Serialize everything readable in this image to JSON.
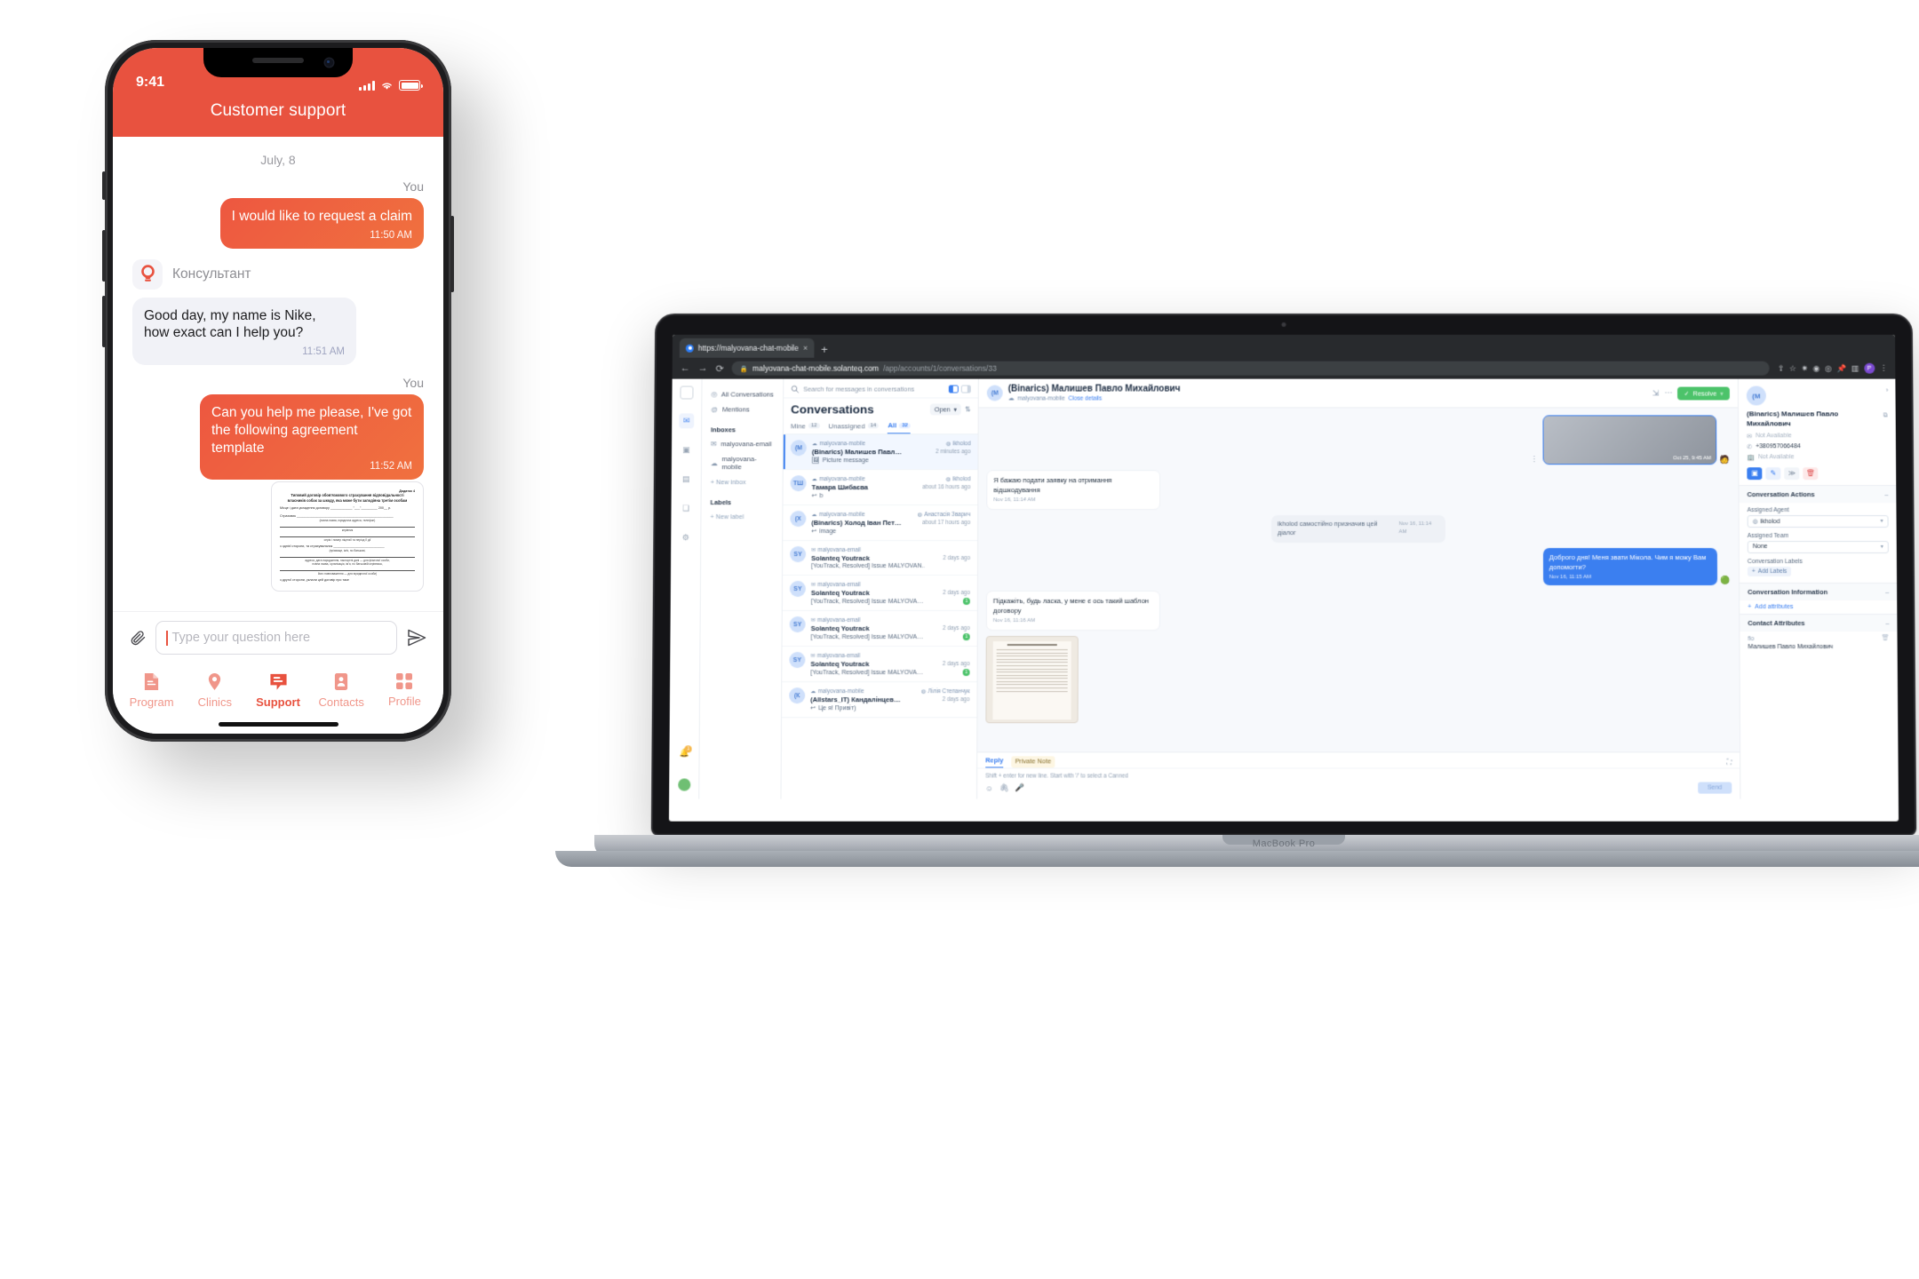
{
  "phone": {
    "status": {
      "time": "9:41"
    },
    "nav_title": "Customer support",
    "day_label": "July, 8",
    "you_label": "You",
    "messages": [
      {
        "side": "out",
        "who": "You",
        "text": "I would like to request a claim",
        "time": "11:50 AM"
      },
      {
        "side": "in",
        "who": "Консультант",
        "text": "Good day, my name is Nike, how exact can I help you?",
        "time": "11:51 AM"
      },
      {
        "side": "out",
        "who": "You",
        "text": "Can you help me please, I've got the following agreement template",
        "time": "11:52 AM"
      }
    ],
    "document": {
      "annex": "Додаток 4",
      "title_line1": "Типовий договір обов'язкового страхування відповідальності",
      "title_line2": "власників собак за шкоду, яка може бути заподіяна третім особам",
      "row_place": "Місце і дата укладення договору ____________ \"___\"_________ 200__ р.",
      "row_insurer": "Страховик _____________________________________________________",
      "cap_fullname": "(повна назва, юридична адреса, телефон)",
      "cap_director": "керівник",
      "cap_series": "серія і номер ліцензії та період її дії",
      "row_party": "з однієї сторони, та страхувальник ____________________________",
      "cap_party": "(прізвище, ім'я, по батькові,",
      "cap_addr": "адреса, дата народження, паспортні дані — для фізичної особи,",
      "cap_addr2": "повна назва, організація, ім'я, по батьковій керівника,",
      "cap_legal": "його повноваження — для юридичної особи)",
      "row_end": "з другої сторони, уклали цей договір про таке"
    },
    "composer": {
      "placeholder": "Type your question here",
      "attach_icon": "paperclip-icon",
      "send_icon": "send-icon"
    },
    "tabs": [
      {
        "label": "Program",
        "icon": "document-icon",
        "active": false
      },
      {
        "label": "Clinics",
        "icon": "map-pin-icon",
        "active": false
      },
      {
        "label": "Support",
        "icon": "chat-bubble-icon",
        "active": true
      },
      {
        "label": "Contacts",
        "icon": "contacts-icon",
        "active": false
      },
      {
        "label": "Profile",
        "icon": "grid-icon",
        "active": false
      }
    ],
    "colors": {
      "accent": "#E8523F",
      "bubble_out": "#ED5740",
      "bubble_in": "#F1F2F7"
    }
  },
  "laptop": {
    "model_label": "MacBook Pro"
  },
  "browser": {
    "tab_title": "https://malyovana-chat-mobile",
    "tab_close": "×",
    "new_tab": "+",
    "url_bold": "malyovana-chat-mobile.solanteq.com",
    "url_path": "/app/accounts/1/conversations/33",
    "back": "←",
    "forward": "→",
    "reload": "⟳",
    "profile_initial": "P"
  },
  "app": {
    "rail": [
      {
        "name": "conversations-icon",
        "glyph": "✉",
        "selected": true
      },
      {
        "name": "contacts-icon",
        "glyph": "▣",
        "selected": false
      },
      {
        "name": "reports-icon",
        "glyph": "▤",
        "selected": false
      },
      {
        "name": "campaigns-icon",
        "glyph": "❏",
        "selected": false
      },
      {
        "name": "settings-icon",
        "glyph": "⚙",
        "selected": false
      }
    ],
    "notification_count": "1",
    "sidebar": {
      "all_conversations": "All Conversations",
      "mentions": "Mentions",
      "inboxes_header": "Inboxes",
      "inboxes": [
        {
          "label": "malyovana-email",
          "icon": "email-icon"
        },
        {
          "label": "malyovana-mobile",
          "icon": "cloud-icon"
        }
      ],
      "new_inbox": "+ New inbox",
      "labels_header": "Labels",
      "new_label": "+ New label"
    },
    "convlist": {
      "search_placeholder": "Search for messages in conversations",
      "title": "Conversations",
      "state_filter": "Open",
      "tabs": [
        {
          "label": "Mine",
          "count": "12",
          "active": false
        },
        {
          "label": "Unassigned",
          "count": "14",
          "active": false
        },
        {
          "label": "All",
          "count": "32",
          "active": true
        }
      ],
      "rows": [
        {
          "avatar": "(M",
          "inbox": "malyovana-mobile",
          "inbox_icon": "cloud-icon",
          "assignee": "ikholod",
          "name": "(Binarics) Малишев Павл…",
          "time": "2 minutes ago",
          "preview": "Picture message",
          "preview_icon": "image-icon",
          "unread": "",
          "selected": true
        },
        {
          "avatar": "ТШ",
          "inbox": "malyovana-mobile",
          "inbox_icon": "cloud-icon",
          "assignee": "ikholod",
          "name": "Тамара Шибаєва",
          "time": "about 16 hours ago",
          "preview": "b",
          "preview_icon": "reply-icon",
          "unread": "",
          "selected": false
        },
        {
          "avatar": "(X",
          "inbox": "malyovana-mobile",
          "inbox_icon": "cloud-icon",
          "assignee": "Анастасія Зварич",
          "name": "(Binarics) Холод Іван Пет…",
          "time": "about 17 hours ago",
          "preview": "image",
          "preview_icon": "reply-icon",
          "unread": "",
          "selected": false
        },
        {
          "avatar": "SY",
          "inbox": "malyovana-email",
          "inbox_icon": "email-icon",
          "assignee": "",
          "name": "Solanteq Youtrack",
          "time": "2 days ago",
          "preview": "[YouTrack, Resolved] Issue MALYOVAN…",
          "preview_icon": "",
          "unread": "",
          "selected": false
        },
        {
          "avatar": "SY",
          "inbox": "malyovana-email",
          "inbox_icon": "email-icon",
          "assignee": "",
          "name": "Solanteq Youtrack",
          "time": "2 days ago",
          "preview": "[YouTrack, Resolved] Issue MALYOVA…",
          "preview_icon": "",
          "unread": "1",
          "selected": false
        },
        {
          "avatar": "SY",
          "inbox": "malyovana-email",
          "inbox_icon": "email-icon",
          "assignee": "",
          "name": "Solanteq Youtrack",
          "time": "2 days ago",
          "preview": "[YouTrack, Resolved] Issue MALYOVA…",
          "preview_icon": "",
          "unread": "1",
          "selected": false
        },
        {
          "avatar": "SY",
          "inbox": "malyovana-email",
          "inbox_icon": "email-icon",
          "assignee": "",
          "name": "Solanteq Youtrack",
          "time": "2 days ago",
          "preview": "[YouTrack, Resolved] Issue MALYOVA…",
          "preview_icon": "",
          "unread": "1",
          "selected": false
        },
        {
          "avatar": "(К",
          "inbox": "malyovana-mobile",
          "inbox_icon": "cloud-icon",
          "assignee": "Лілія Степанчук",
          "name": "(Allstars_IT) Кандалінцев…",
          "time": "2 days ago",
          "preview": "Це я! Привіт)",
          "preview_icon": "reply-icon",
          "unread": "",
          "selected": false
        }
      ]
    },
    "thread": {
      "title": "(Binarics) Малишев Павло Михайлович",
      "inbox": "malyovana-mobile",
      "close_details": "Close details",
      "resolve_label": "Resolve",
      "resolve_check": "✓",
      "messages": [
        {
          "kind": "image",
          "side": "right",
          "time": "Oct 25, 9:45 AM"
        },
        {
          "kind": "text",
          "side": "left",
          "text": "Я бажаю подати заявку на отримання відшкодування",
          "time": "Nov 16, 11:14 AM"
        },
        {
          "kind": "system",
          "side": "center",
          "text": "ikholod самостійно призначив цей діалог",
          "time": "Nov 16, 11:14 AM"
        },
        {
          "kind": "text",
          "side": "right",
          "text": "Доброго дня! Меня звати Мікола. Чим я можу Вам допомогти?",
          "time": "Nov 16, 11:15 AM"
        },
        {
          "kind": "text",
          "side": "left",
          "text": "Підкажіть, будь ласка, у мене є ось такий шаблон договору",
          "time": "Nov 16, 11:16 AM"
        },
        {
          "kind": "scan",
          "side": "left",
          "time": ""
        }
      ],
      "composer": {
        "tab_reply": "Reply",
        "tab_note": "Private Note",
        "hint": "Shift + enter for new line. Start with '/' to select a Canned",
        "send_label": "Send",
        "emoji_icon": "emoji-icon",
        "attach_icon": "paperclip-icon",
        "mic_icon": "microphone-icon",
        "expand_icon": "expand-icon"
      }
    },
    "detail": {
      "avatar": "(M",
      "name": "(Binarics) Малишев Павло Михайлович",
      "email": "Not Available",
      "phone": "+380957066484",
      "company": "Not Available",
      "action_buttons": [
        {
          "name": "message-button",
          "glyph": "▣"
        },
        {
          "name": "edit-button",
          "glyph": "✎"
        },
        {
          "name": "merge-button",
          "glyph": "≫"
        },
        {
          "name": "delete-button",
          "glyph": "🗑"
        }
      ],
      "sections": [
        {
          "title": "Conversation Actions",
          "collapse": "–"
        },
        {
          "title": "Conversation Information",
          "collapse": "–"
        },
        {
          "title": "Contact Attributes",
          "collapse": "–"
        }
      ],
      "assigned_agent_label": "Assigned Agent",
      "assigned_agent_value": "ikholod",
      "assigned_team_label": "Assigned Team",
      "assigned_team_value": "None",
      "labels_label": "Conversation Labels",
      "add_labels": "Add Labels",
      "add_attributes": "Add attributes",
      "attr_key": "fio",
      "attr_value": "Малишев Павло Михайлович"
    }
  }
}
